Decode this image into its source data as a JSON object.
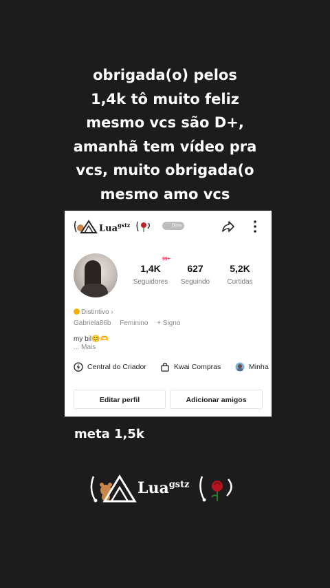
{
  "caption": {
    "lines": [
      "obrigada(o) pelos",
      "1,4k tô muito feliz",
      "mesmo vcs são D+,",
      "amanhã tem vídeo pra",
      "vcs, muito obrigada(o",
      "mesmo amo vcs"
    ]
  },
  "profile": {
    "username": "Lua",
    "username_suffix": "gstz",
    "toggle_label": "Dons",
    "stats": [
      {
        "value": "1,4K",
        "label": "Seguidores"
      },
      {
        "value": "627",
        "label": "Seguindo"
      },
      {
        "value": "5,2K",
        "label": "Curtidas"
      }
    ],
    "followers_badge": "99+",
    "distintivo": "Distintivo ›",
    "handle": "Gabriela86b",
    "gender": "Feminino",
    "sign": "+ Signo",
    "bio": "my bil😊🫶",
    "more": "... Mais",
    "shortcuts": [
      "Central do Criador",
      "Kwai Compras",
      "Minha"
    ],
    "buttons": {
      "edit": "Editar perfil",
      "add_friends": "Adicionar amigos"
    }
  },
  "meta_text": "meta 1,5k",
  "signature": {
    "name": "Lua",
    "suffix": "gstz"
  },
  "icons": [
    "share-icon",
    "more-options-icon",
    "lightning-icon",
    "shopping-bag-icon",
    "avatar-mini-icon",
    "rose-icon",
    "bear-icon",
    "triangle-logo-icon"
  ],
  "colors": {
    "background": "#1c1c1c",
    "card": "#ffffff",
    "badge": "#fe2c55",
    "distintivo": "#f5b10a"
  }
}
